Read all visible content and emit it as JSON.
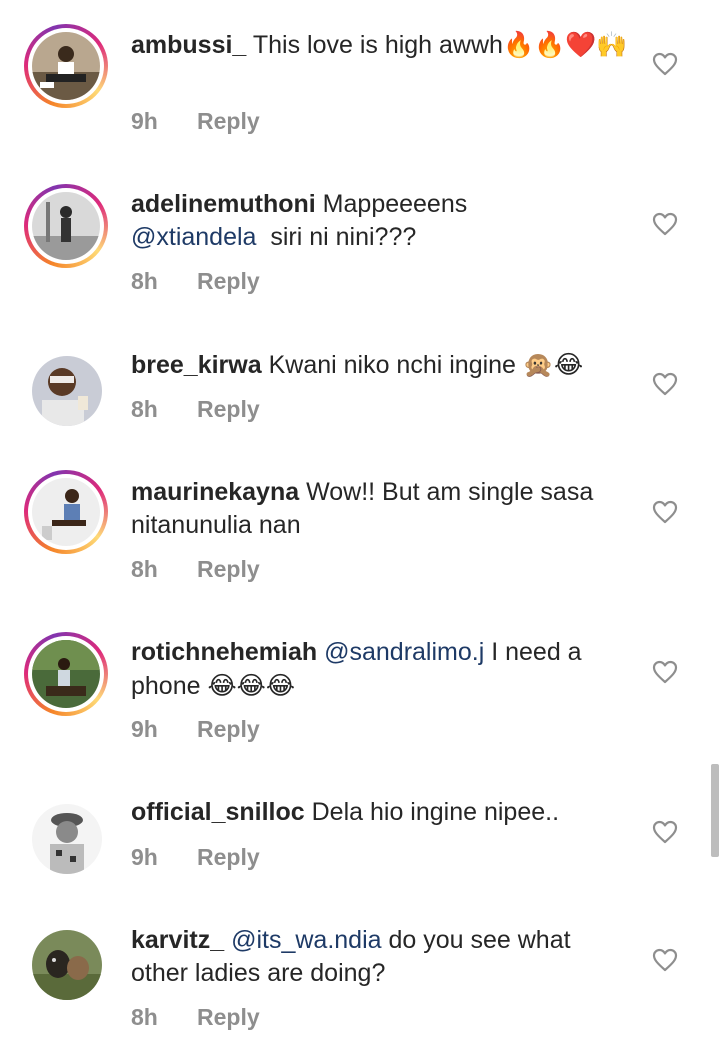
{
  "comments": [
    {
      "username": "ambussi_",
      "text_before": " This love is high awwh",
      "emoji": "🔥🔥❤️🙌",
      "time": "9h",
      "reply": "Reply"
    },
    {
      "username": "adelinemuthoni",
      "text_before": " Mappeeeens",
      "mention": "@xtiandela",
      "text_after": "  siri ni nini???",
      "time": "8h",
      "reply": "Reply"
    },
    {
      "username": "bree_kirwa",
      "text_before": " Kwani niko nchi ingine ",
      "emoji": "🙊😂",
      "time": "8h",
      "reply": "Reply"
    },
    {
      "username": "maurinekayna",
      "text_before": " Wow!! But am single sasa nitanunulia nan",
      "time": "8h",
      "reply": "Reply"
    },
    {
      "username": "rotichnehemiah",
      "mention": "@sandralimo.j",
      "text_after": " I need a phone ",
      "emoji": "😂😂😂",
      "time": "9h",
      "reply": "Reply"
    },
    {
      "username": "official_snilloc",
      "text_before": " Dela hio ingine nipee..",
      "time": "9h",
      "reply": "Reply"
    },
    {
      "username": "karvitz_",
      "mention": "@its_wa.ndia",
      "text_after": " do you see what other ladies are doing?",
      "time": "8h",
      "reply": "Reply"
    }
  ],
  "colors": {
    "text": "#262626",
    "meta": "#8e8e8e",
    "mention": "#1e3a66",
    "story_ring": "#dd2a7b"
  },
  "icons": {
    "like": "heart-outline-icon"
  }
}
